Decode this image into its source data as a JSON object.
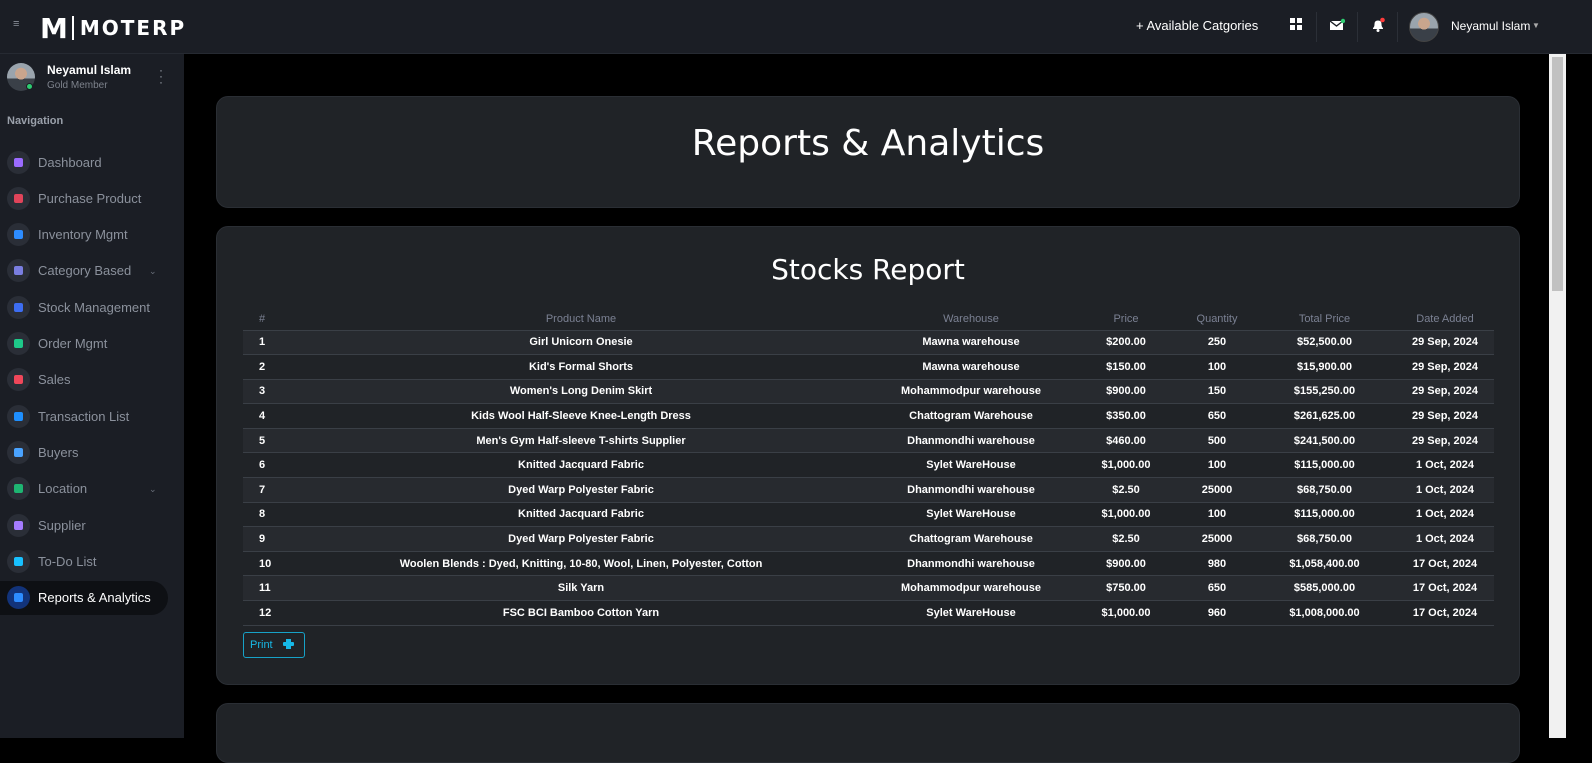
{
  "topbar": {
    "logo_mark": "M",
    "logo_text": "MOTERP",
    "categories_link": "+ Available Catgories",
    "user_name": "Neyamul Islam"
  },
  "sidebar": {
    "user_name": "Neyamul Islam",
    "user_role": "Gold Member",
    "section_label": "Navigation",
    "items": [
      {
        "label": "Dashboard",
        "icon": "gauge-icon",
        "color": "#9b6bff"
      },
      {
        "label": "Purchase Product",
        "icon": "list-icon",
        "color": "#e0445a"
      },
      {
        "label": "Inventory Mgmt",
        "icon": "inventory-icon",
        "color": "#2d8cff"
      },
      {
        "label": "Category Based",
        "icon": "category-list-icon",
        "color": "#7a7ee0"
      },
      {
        "label": "Stock Management",
        "icon": "stock-icon",
        "color": "#3d6df2"
      },
      {
        "label": "Order Mgmt",
        "icon": "layers-icon",
        "color": "#1ec98a"
      },
      {
        "label": "Sales",
        "icon": "bar-chart-icon",
        "color": "#f0475a"
      },
      {
        "label": "Transaction List",
        "icon": "card-list-icon",
        "color": "#1e8fff"
      },
      {
        "label": "Buyers",
        "icon": "people-icon",
        "color": "#4aa3ff"
      },
      {
        "label": "Location",
        "icon": "globe-icon",
        "color": "#1eb572"
      },
      {
        "label": "Supplier",
        "icon": "factory-icon",
        "color": "#a57cff"
      },
      {
        "label": "To-Do List",
        "icon": "check-circle-icon",
        "color": "#18c0ff"
      },
      {
        "label": "Reports & Analytics",
        "icon": "server-icon",
        "color": "#2d8cff"
      }
    ]
  },
  "page": {
    "title": "Reports & Analytics"
  },
  "report": {
    "title": "Stocks Report",
    "columns": [
      "#",
      "Product Name",
      "Warehouse",
      "Price",
      "Quantity",
      "Total Price",
      "Date Added"
    ],
    "rows": [
      [
        "1",
        "Girl Unicorn Onesie",
        "Mawna warehouse",
        "$200.00",
        "250",
        "$52,500.00",
        "29 Sep, 2024"
      ],
      [
        "2",
        "Kid's Formal Shorts",
        "Mawna warehouse",
        "$150.00",
        "100",
        "$15,900.00",
        "29 Sep, 2024"
      ],
      [
        "3",
        "Women's Long Denim Skirt",
        "Mohammodpur warehouse",
        "$900.00",
        "150",
        "$155,250.00",
        "29 Sep, 2024"
      ],
      [
        "4",
        "Kids Wool Half-Sleeve Knee-Length Dress",
        "Chattogram Warehouse",
        "$350.00",
        "650",
        "$261,625.00",
        "29 Sep, 2024"
      ],
      [
        "5",
        "Men's Gym Half-sleeve T-shirts Supplier",
        "Dhanmondhi warehouse",
        "$460.00",
        "500",
        "$241,500.00",
        "29 Sep, 2024"
      ],
      [
        "6",
        "Knitted Jacquard Fabric",
        "Sylet WareHouse",
        "$1,000.00",
        "100",
        "$115,000.00",
        "1 Oct, 2024"
      ],
      [
        "7",
        "Dyed Warp Polyester Fabric",
        "Dhanmondhi warehouse",
        "$2.50",
        "25000",
        "$68,750.00",
        "1 Oct, 2024"
      ],
      [
        "8",
        "Knitted Jacquard Fabric",
        "Sylet WareHouse",
        "$1,000.00",
        "100",
        "$115,000.00",
        "1 Oct, 2024"
      ],
      [
        "9",
        "Dyed Warp Polyester Fabric",
        "Chattogram Warehouse",
        "$2.50",
        "25000",
        "$68,750.00",
        "1 Oct, 2024"
      ],
      [
        "10",
        "Woolen Blends : Dyed, Knitting, 10-80, Wool, Linen, Polyester, Cotton",
        "Dhanmondhi warehouse",
        "$900.00",
        "980",
        "$1,058,400.00",
        "17 Oct, 2024"
      ],
      [
        "11",
        "Silk Yarn",
        "Mohammodpur warehouse",
        "$750.00",
        "650",
        "$585,000.00",
        "17 Oct, 2024"
      ],
      [
        "12",
        "FSC BCI Bamboo Cotton Yarn",
        "Sylet WareHouse",
        "$1,000.00",
        "960",
        "$1,008,000.00",
        "17 Oct, 2024"
      ]
    ],
    "print_label": "Print"
  }
}
